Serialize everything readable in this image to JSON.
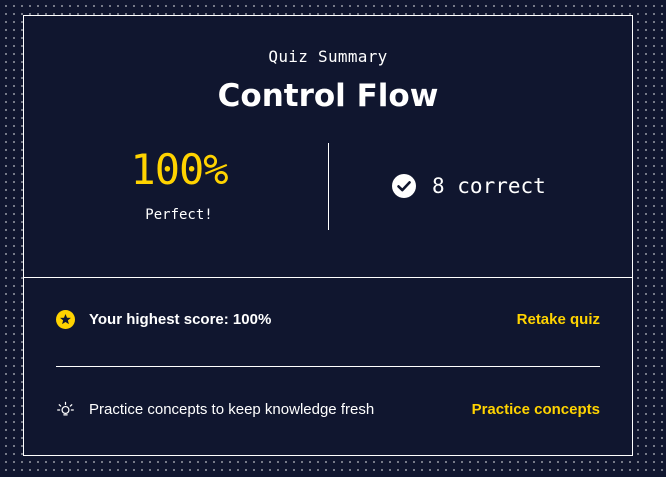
{
  "summary": {
    "subtitle": "Quiz Summary",
    "title": "Control Flow",
    "score": "100%",
    "score_caption": "Perfect!",
    "correct_text": "8 correct"
  },
  "actions": {
    "highest_score_text": "Your highest score: 100%",
    "retake_label": "Retake quiz",
    "practice_text": "Practice concepts to keep knowledge fresh",
    "practice_label": "Practice concepts"
  },
  "icons": {
    "check": "check-circle-icon",
    "star": "star-circle-icon",
    "bulb": "lightbulb-icon"
  },
  "colors": {
    "background": "#10162f",
    "accent": "#ffd300",
    "text": "#ffffff"
  }
}
